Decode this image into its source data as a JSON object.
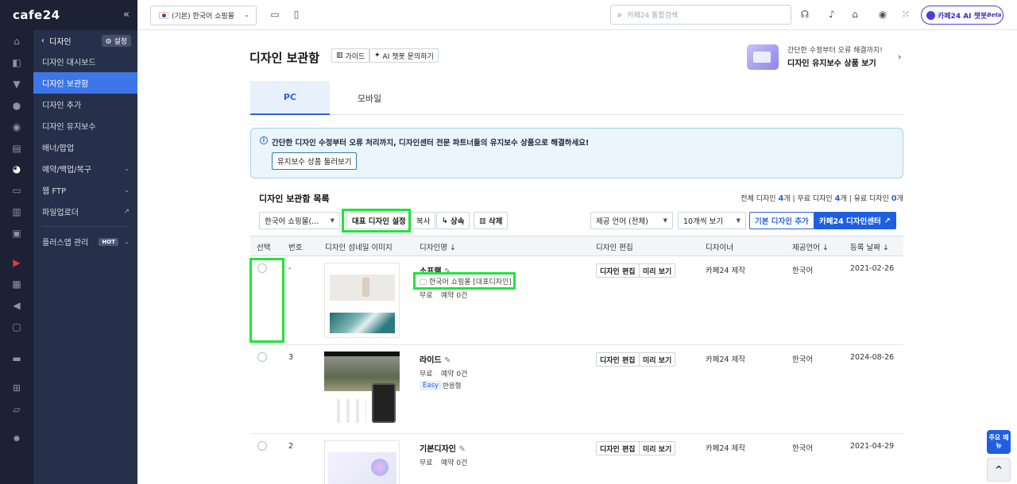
{
  "brand": {
    "logo": "cafe24",
    "collapse": "«"
  },
  "rail_icons": [
    "home-icon",
    "cart-icon",
    "shirt-icon",
    "user-icon",
    "chat-icon",
    "board-icon",
    "palette-icon",
    "promo-icon",
    "chart-icon",
    "excel-icon",
    "youtube-icon",
    "store-icon",
    "megaphone-icon",
    "box-icon",
    "truck-icon",
    "apps-icon",
    "folder-icon",
    "gear-icon"
  ],
  "submenu": {
    "header": "디자인",
    "settings": "설정",
    "items": [
      {
        "label": "디자인 대시보드"
      },
      {
        "label": "디자인 보관함"
      },
      {
        "label": "디자인 추가"
      },
      {
        "label": "디자인 유지보수"
      },
      {
        "label": "배너/팝업"
      },
      {
        "label": "예약/백업/복구"
      },
      {
        "label": "웹 FTP"
      },
      {
        "label": "파일업로더"
      },
      {
        "label": "플러스앱 관리",
        "badge": "HOT"
      }
    ]
  },
  "topbar": {
    "shop_select": "(기본) 한국어 쇼핑몰",
    "search_placeholder": "카페24 통합검색",
    "ai_button": "카페24 AI 챗봇",
    "ai_beta": "Beta"
  },
  "page": {
    "title": "디자인 보관함",
    "guide": "가이드",
    "ai_chat": "AI 챗봇 문의하기",
    "promo_line1": "간단한 수정부터 오류 해결까지!",
    "promo_line2": "디자인 유지보수 상품 보기",
    "tabs": [
      "PC",
      "모바일"
    ],
    "notice": "간단한 디자인 수정부터 오류 처리까지, 디자인센터 전문 파트너들의 유지보수 상품으로 해결하세요!",
    "notice_button": "유지보수 상품 둘러보기",
    "list_title": "디자인 보관함 목록",
    "counts": {
      "total_label": "전체 디자인",
      "total": "4",
      "free_label": "무료 디자인",
      "free": "4",
      "paid_label": "유료 디자인",
      "paid": "0",
      "unit": "개"
    }
  },
  "toolbar": {
    "shop_filter": "한국어 쇼핑몰(...",
    "set_main": "대표 디자인 설정",
    "copy": "복사",
    "inherit": "상속",
    "delete": "삭제",
    "lang_filter": "제공 언어 (전체)",
    "per_page": "10개씩 보기",
    "add_basic": "기본 디자인 추가",
    "design_center": "카페24 디자인센터"
  },
  "table": {
    "headers": [
      "선택",
      "번호",
      "디자인 섬네일 이미지",
      "디자인명",
      "디자인 편집",
      "디자이너",
      "제공언어",
      "등록 날짜"
    ],
    "rows": [
      {
        "no": "-",
        "name": "소프램",
        "sub": "한국어 쇼핑몰 [대표디자인]",
        "price": "무료",
        "reserve": "예약 0건",
        "edit": "디자인 편집",
        "preview": "미리 보기",
        "designer": "카페24 제작",
        "lang": "한국어",
        "date": "2021-02-26"
      },
      {
        "no": "3",
        "name": "라이드",
        "price": "무료",
        "reserve": "예약 0건",
        "tag1": "Easy",
        "tag2": "반응형",
        "edit": "디자인 편집",
        "preview": "미리 보기",
        "designer": "카페24 제작",
        "lang": "한국어",
        "date": "2024-08-26"
      },
      {
        "no": "2",
        "name": "기본디자인",
        "price": "무료",
        "reserve": "예약 0건",
        "edit": "디자인 편집",
        "preview": "미리 보기",
        "designer": "카페24 제작",
        "lang": "한국어",
        "date": "2021-04-29"
      }
    ]
  },
  "fab": {
    "main_menu": "주요 메뉴",
    "top": "^"
  },
  "colors": {
    "accent": "#1e5fe0",
    "highlight": "#22e33c",
    "sidebar": "#27304a"
  }
}
